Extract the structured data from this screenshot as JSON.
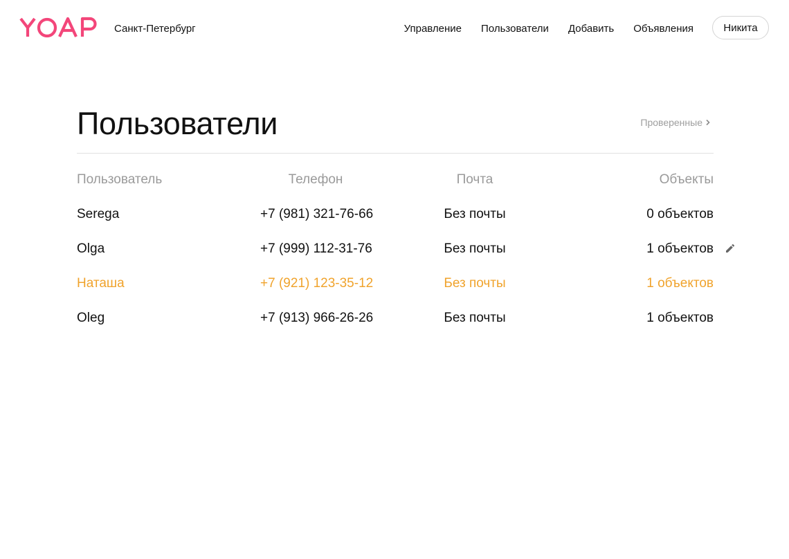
{
  "header": {
    "logo_text": "YOAP",
    "logo_color": "#f3467a",
    "city": "Санкт-Петербург",
    "nav": [
      {
        "label": "Управление"
      },
      {
        "label": "Пользователи"
      },
      {
        "label": "Добавить"
      },
      {
        "label": "Объявления"
      }
    ],
    "user_button": "Никита"
  },
  "main": {
    "title": "Пользователи",
    "verified_link": "Проверенные",
    "verified_icon": "chevron-right-icon",
    "table": {
      "columns": [
        "Пользователь",
        "Телефон",
        "Почта",
        "Объекты"
      ],
      "rows": [
        {
          "name": "Serega",
          "phone": "+7 (981) 321-76-66",
          "email": "Без почты",
          "objects": "0 объектов"
        },
        {
          "name": "Olga",
          "phone": "+7 (999) 112-31-76",
          "email": "Без почты",
          "objects": "1 объектов"
        },
        {
          "name": "Наташа",
          "phone": "+7 (921) 123-35-12",
          "email": "Без почты",
          "objects": "1 объектов"
        },
        {
          "name": "Oleg",
          "phone": "+7 (913) 966-26-26",
          "email": "Без почты",
          "objects": "1 объектов"
        }
      ],
      "highlight_color": "#f0a32c",
      "edit_icon": "pencil-icon"
    }
  }
}
